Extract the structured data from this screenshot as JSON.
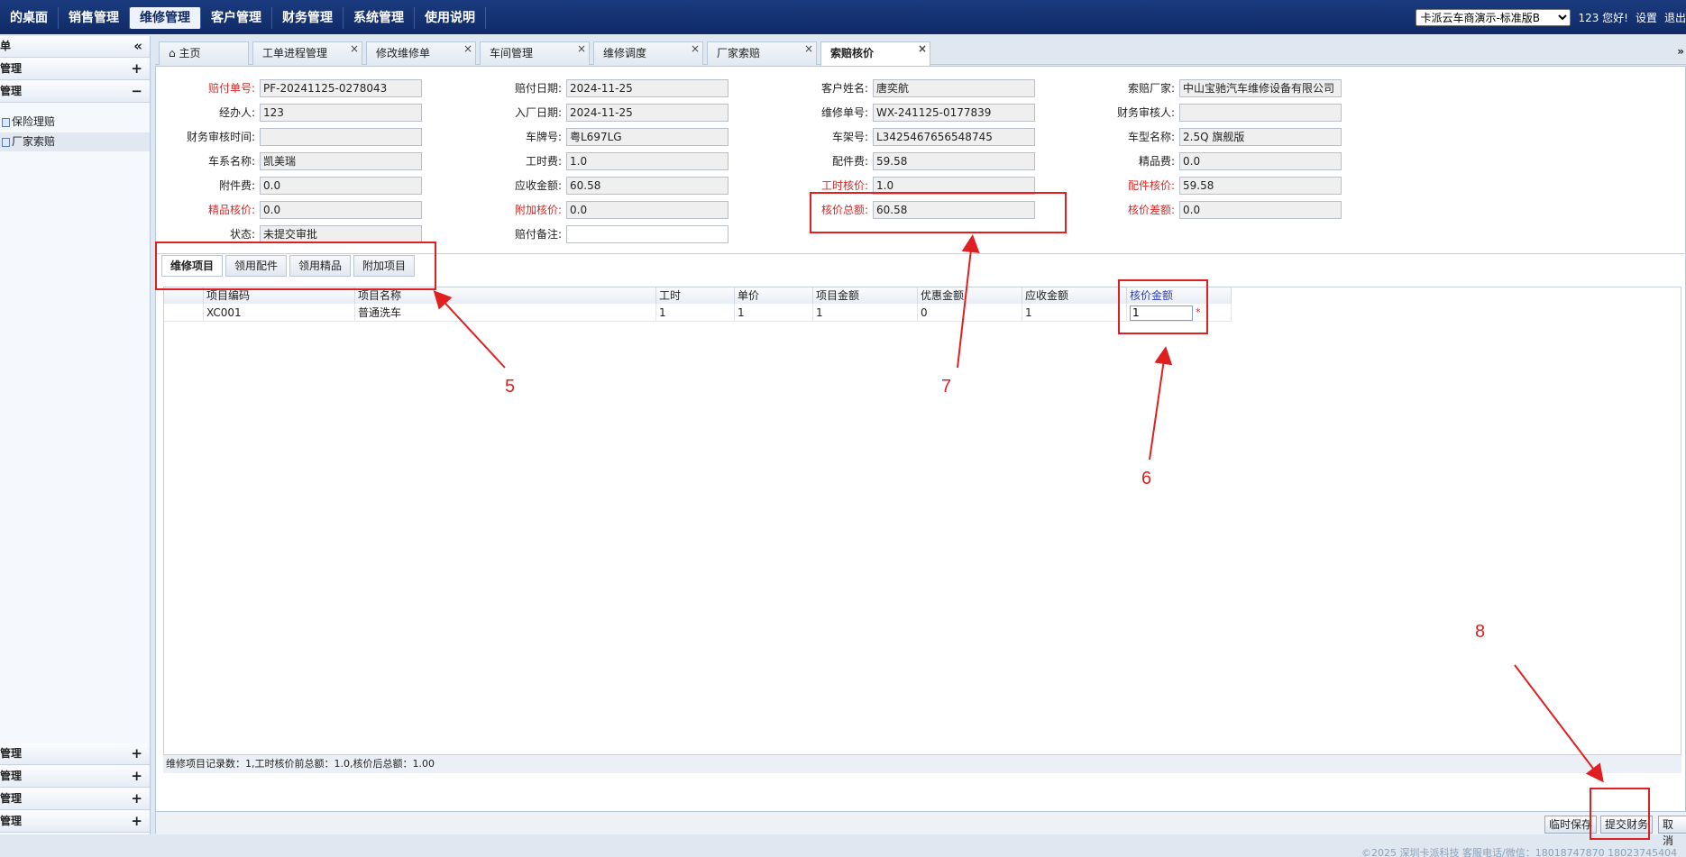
{
  "nav": {
    "items": [
      "的桌面",
      "销售管理",
      "维修管理",
      "客户管理",
      "财务管理",
      "系统管理",
      "使用说明"
    ],
    "active_index": 2,
    "store_select": "卡派云车商演示-标准版B",
    "user_text": "123 您好!",
    "settings": "设置",
    "logout": "退出"
  },
  "sidebar": {
    "header": "单",
    "collapse_icon": "«",
    "group1": "管理",
    "group2": "管理",
    "sub1": "保险理赔",
    "sub2": "厂家索赔",
    "bottom_groups": [
      "管理",
      "管理",
      "管理",
      "管理"
    ],
    "plus": "+",
    "minus": "−"
  },
  "tabs": {
    "home": "主页",
    "items": [
      "工单进程管理",
      "修改维修单",
      "车间管理",
      "维修调度",
      "厂家索赔",
      "索赔核价"
    ],
    "active": "索赔核价",
    "close": "×"
  },
  "form": {
    "l_claim_no": "赔付单号:",
    "v_claim_no": "PF-20241125-0278043",
    "l_claim_date": "赔付日期:",
    "v_claim_date": "2024-11-25",
    "l_customer": "客户姓名:",
    "v_customer": "唐奕航",
    "l_maker": "索赔厂家:",
    "v_maker": "中山宝驰汽车维修设备有限公司",
    "l_handler": "经办人:",
    "v_handler": "123",
    "l_in_date": "入厂日期:",
    "v_in_date": "2024-11-25",
    "l_repair_no": "维修单号:",
    "v_repair_no": "WX-241125-0177839",
    "l_fin_reviewer": "财务审核人:",
    "v_fin_reviewer": "",
    "l_fin_time": "财务审核时间:",
    "v_fin_time": "",
    "l_plate": "车牌号:",
    "v_plate": "粤L697LG",
    "l_vin": "车架号:",
    "v_vin": "L3425467656548745",
    "l_model": "车型名称:",
    "v_model": "2.5Q 旗舰版",
    "l_series": "车系名称:",
    "v_series": "凯美瑞",
    "l_labor": "工时费:",
    "v_labor": "1.0",
    "l_parts": "配件费:",
    "v_parts": "59.58",
    "l_boutique": "精品费:",
    "v_boutique": "0.0",
    "l_attach": "附件费:",
    "v_attach": "0.0",
    "l_receivable": "应收金额:",
    "v_receivable": "60.58",
    "l_labor_check": "工时核价:",
    "v_labor_check": "1.0",
    "l_parts_check": "配件核价:",
    "v_parts_check": "59.58",
    "l_boutique_check": "精品核价:",
    "v_boutique_check": "0.0",
    "l_extra_check": "附加核价:",
    "v_extra_check": "0.0",
    "l_total_check": "核价总额:",
    "v_total_check": "60.58",
    "l_diff_check": "核价差额:",
    "v_diff_check": "0.0",
    "l_status": "状态:",
    "v_status": "未提交审批",
    "l_remark": "赔付备注:",
    "v_remark": ""
  },
  "subtabs": [
    "维修项目",
    "领用配件",
    "领用精品",
    "附加项目"
  ],
  "grid": {
    "headers": [
      "项目编码",
      "项目名称",
      "工时",
      "单价",
      "项目金额",
      "优惠金额",
      "应收金额",
      "核价金额"
    ],
    "row": [
      "XC001",
      "普通洗车",
      "1",
      "1",
      "1",
      "0",
      "1",
      "1"
    ],
    "required": "*"
  },
  "grid_footer": "维修项目记录数：1,工时核价前总额：1.0,核价后总额：1.00",
  "buttons": {
    "temp_save": "临时保存",
    "submit_finance": "提交财务",
    "cancel": "取消"
  },
  "copyright": "©2025 深圳卡派科技 客服电话/微信：18018747870 18023745404",
  "annotations": [
    "5",
    "6",
    "7",
    "8"
  ],
  "colors": {
    "nav_bg": "#0f2a66",
    "annotation": "#e02020",
    "required_label": "#d42a2a"
  }
}
